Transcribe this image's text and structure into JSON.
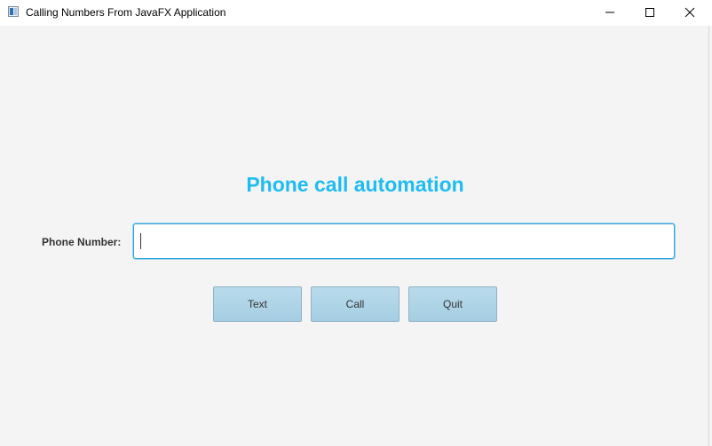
{
  "window": {
    "title": "Calling Numbers From JavaFX Application",
    "controls": [
      "minimize",
      "maximize",
      "close"
    ]
  },
  "main": {
    "heading": "Phone call automation",
    "phone_label": "Phone Number:",
    "phone_input": {
      "value": "",
      "placeholder": ""
    },
    "buttons": {
      "text_label": "Text",
      "call_label": "Call",
      "quit_label": "Quit"
    }
  },
  "colors": {
    "heading": "#1ebcf0",
    "button_fill": "#a9d0e4",
    "input_focus_border": "#2ba3d6",
    "background": "#f4f4f4"
  },
  "icons": [
    "app-icon",
    "minimize-icon",
    "maximize-icon",
    "close-icon"
  ]
}
